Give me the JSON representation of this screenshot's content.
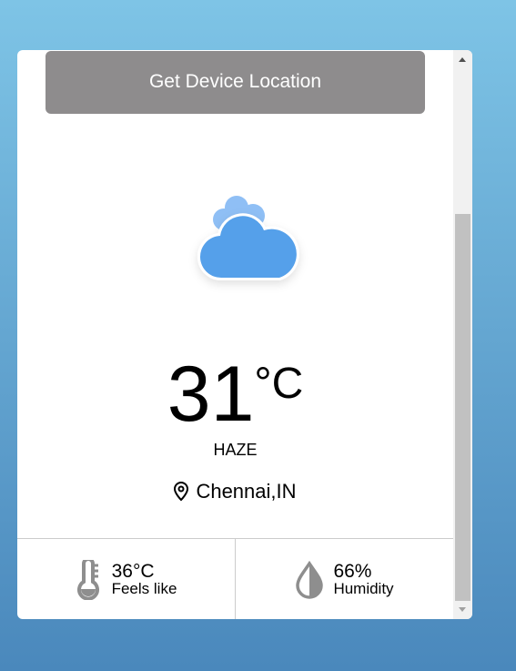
{
  "button": {
    "label": "Get Device Location"
  },
  "weather": {
    "icon": "haze-cloud-icon",
    "temperature": "31",
    "unit": "°C",
    "description": "HAZE",
    "location": "Chennai,IN"
  },
  "details": [
    {
      "icon": "thermometer-icon",
      "value": "36°C",
      "label": "Feels like"
    },
    {
      "icon": "water-drop-icon",
      "value": "66%",
      "label": "Humidity"
    }
  ],
  "colors": {
    "button": "#8e8c8d",
    "cloud": "#55a0ea",
    "cloud_back": "#8fbff5",
    "icon_gray": "#8e8e8e"
  }
}
